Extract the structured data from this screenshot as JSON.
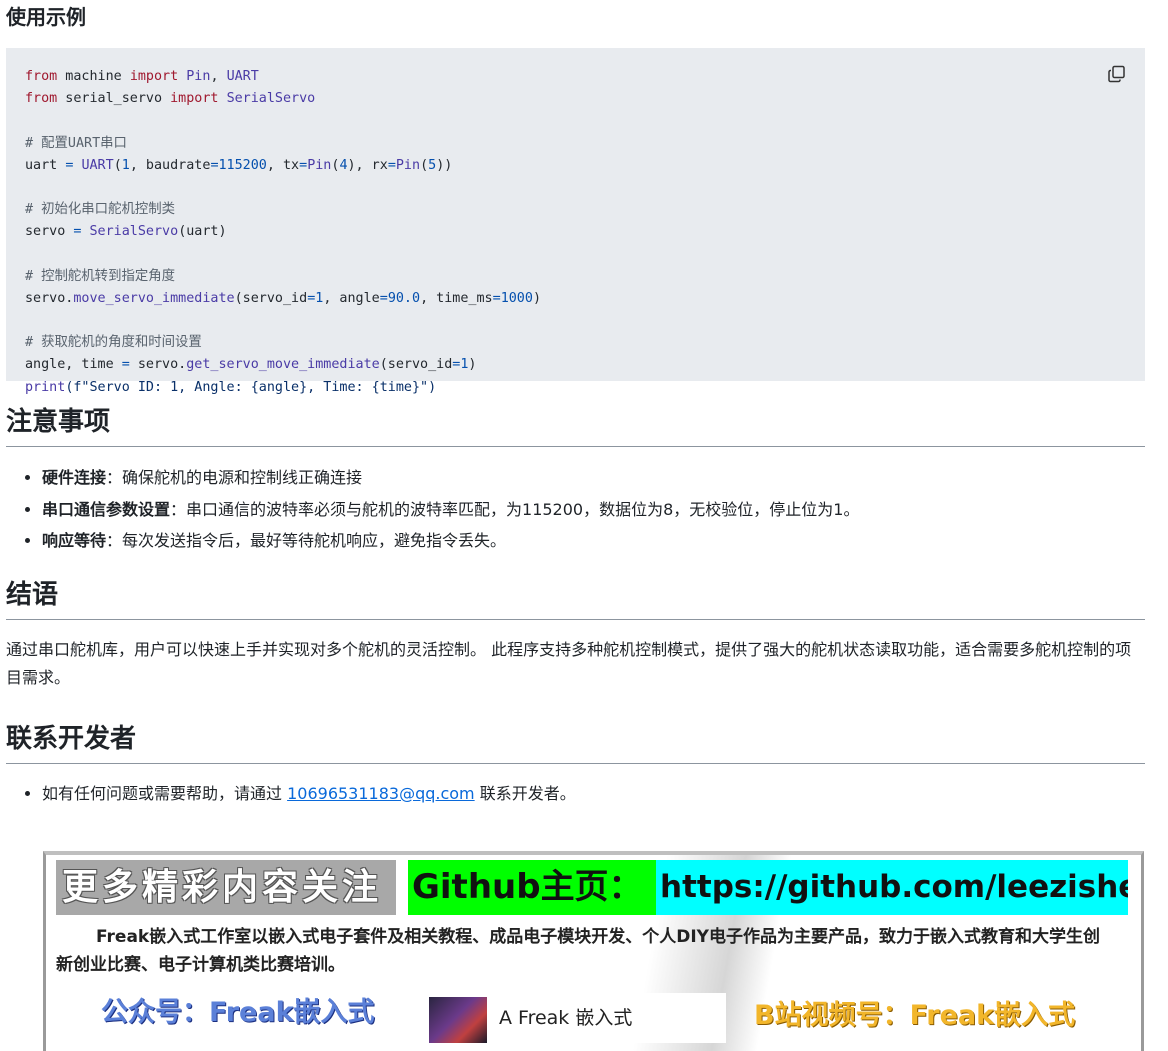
{
  "example": {
    "heading": "使用示例",
    "code_lines": [
      [
        {
          "t": "from",
          "c": "kw"
        },
        {
          "t": " machine "
        },
        {
          "t": "import",
          "c": "kw"
        },
        {
          "t": " "
        },
        {
          "t": "Pin",
          "c": "fn"
        },
        {
          "t": ", "
        },
        {
          "t": "UART",
          "c": "fn"
        }
      ],
      [
        {
          "t": "from",
          "c": "kw"
        },
        {
          "t": " serial_servo "
        },
        {
          "t": "import",
          "c": "kw"
        },
        {
          "t": " "
        },
        {
          "t": "SerialServo",
          "c": "fn"
        }
      ],
      [],
      [
        {
          "t": "# 配置UART串口",
          "c": "cm"
        }
      ],
      [
        {
          "t": "uart "
        },
        {
          "t": "=",
          "c": "op"
        },
        {
          "t": " "
        },
        {
          "t": "UART",
          "c": "fn"
        },
        {
          "t": "("
        },
        {
          "t": "1",
          "c": "nu"
        },
        {
          "t": ", baudrate"
        },
        {
          "t": "=",
          "c": "op"
        },
        {
          "t": "115200",
          "c": "nu"
        },
        {
          "t": ", tx"
        },
        {
          "t": "=",
          "c": "op"
        },
        {
          "t": "Pin",
          "c": "fn"
        },
        {
          "t": "("
        },
        {
          "t": "4",
          "c": "nu"
        },
        {
          "t": "), rx"
        },
        {
          "t": "=",
          "c": "op"
        },
        {
          "t": "Pin",
          "c": "fn"
        },
        {
          "t": "("
        },
        {
          "t": "5",
          "c": "nu"
        },
        {
          "t": "))"
        }
      ],
      [],
      [
        {
          "t": "# 初始化串口舵机控制类",
          "c": "cm"
        }
      ],
      [
        {
          "t": "servo "
        },
        {
          "t": "=",
          "c": "op"
        },
        {
          "t": " "
        },
        {
          "t": "SerialServo",
          "c": "fn"
        },
        {
          "t": "(uart)"
        }
      ],
      [],
      [
        {
          "t": "# 控制舵机转到指定角度",
          "c": "cm"
        }
      ],
      [
        {
          "t": "servo."
        },
        {
          "t": "move_servo_immediate",
          "c": "fn"
        },
        {
          "t": "(servo_id"
        },
        {
          "t": "=",
          "c": "op"
        },
        {
          "t": "1",
          "c": "nu"
        },
        {
          "t": ", angle"
        },
        {
          "t": "=",
          "c": "op"
        },
        {
          "t": "90.0",
          "c": "nu"
        },
        {
          "t": ", time_ms"
        },
        {
          "t": "=",
          "c": "op"
        },
        {
          "t": "1000",
          "c": "nu"
        },
        {
          "t": ")"
        }
      ],
      [],
      [
        {
          "t": "# 获取舵机的角度和时间设置",
          "c": "cm"
        }
      ],
      [
        {
          "t": "angle, time "
        },
        {
          "t": "=",
          "c": "op"
        },
        {
          "t": " servo."
        },
        {
          "t": "get_servo_move_immediate",
          "c": "fn"
        },
        {
          "t": "(servo_id"
        },
        {
          "t": "=",
          "c": "op"
        },
        {
          "t": "1",
          "c": "nu"
        },
        {
          "t": ")"
        }
      ],
      [
        {
          "t": "print",
          "c": "fn"
        },
        {
          "t": "(f\"Servo ID: 1, Angle: {angle}, Time: {time}\")",
          "c": "st"
        }
      ]
    ]
  },
  "notes": {
    "heading": "注意事项",
    "items": [
      {
        "label": "硬件连接",
        "text": "：确保舵机的电源和控制线正确连接"
      },
      {
        "label": "串口通信参数设置",
        "text": "：串口通信的波特率必须与舵机的波特率匹配，为115200，数据位为8，无校验位，停止位为1。"
      },
      {
        "label": "响应等待",
        "text": "：每次发送指令后，最好等待舵机响应，避免指令丢失。"
      }
    ]
  },
  "conclusion": {
    "heading": "结语",
    "text": "通过串口舵机库，用户可以快速上手并实现对多个舵机的灵活控制。 此程序支持多种舵机控制模式，提供了强大的舵机状态读取功能，适合需要多舵机控制的项目需求。"
  },
  "contact": {
    "heading": "联系开发者",
    "before": "如有任何问题或需要帮助，请通过 ",
    "email": "10696531183@qq.com",
    "after": " 联系开发者。"
  },
  "banner": {
    "follow": "更多精彩内容关注",
    "github_label": "Github主页：",
    "github_url": "https://github.com/leezisheng",
    "description": "Freak嵌入式工作室以嵌入式电子套件及相关教程、成品电子模块开发、个人DIY电子作品为主要产品，致力于嵌入式教育和大学生创新创业比赛、电子计算机类比赛培训。",
    "wechat": "公众号：Freak嵌入式",
    "card_name": "A Freak 嵌入式",
    "bilibili": "B站视频号：Freak嵌入式"
  }
}
